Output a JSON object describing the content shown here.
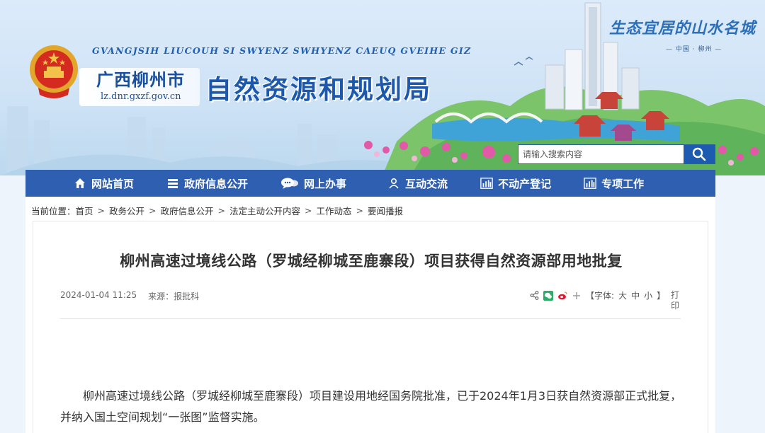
{
  "header": {
    "zhuang_name": "GVANGJSIH LIUCOUH SI SWYENZ SWHYENZ CAEUQ GVEIHE GIZ",
    "city_name": "广西柳州市",
    "domain": "lz.dnr.gxzf.gov.cn",
    "bureau_name": "自然资源和规划局",
    "slogan": "生态宜居的山水名城",
    "slogan_sub": "— 中国 · 柳州 —"
  },
  "search": {
    "placeholder": "请输入搜索内容",
    "icon": "search-icon"
  },
  "nav": {
    "items": [
      {
        "label": "网站首页",
        "icon": "home-icon"
      },
      {
        "label": "政府信息公开",
        "icon": "document-icon"
      },
      {
        "label": "网上办事",
        "icon": "chat-icon"
      },
      {
        "label": "互动交流",
        "icon": "user-icon"
      },
      {
        "label": "不动产登记",
        "icon": "bar-chart-icon"
      },
      {
        "label": "专项工作",
        "icon": "bar-chart-icon"
      }
    ]
  },
  "breadcrumb": {
    "prefix": "当前位置：",
    "items": [
      "首页",
      "政务公开",
      "政府信息公开",
      "法定主动公开内容",
      "工作动态",
      "要闻播报"
    ],
    "separator": ">"
  },
  "article": {
    "title": "柳州高速过境线公路（罗城经柳城至鹿寨段）项目获得自然资源部用地批复",
    "date": "2024-01-04 11:25",
    "source": "来源：报批科",
    "font_size_label": "【字体:",
    "font_large": "大",
    "font_medium": "中",
    "font_small": "小",
    "font_size_close": "】",
    "print": "打印",
    "body": "柳州高速过境线公路（罗城经柳城至鹿寨段）项目建设用地经国务院批准，已于2024年1月3日获自然资源部正式批复，并纳入国土空间规划“一张图”监督实施。"
  },
  "colors": {
    "nav_bg": "#2e5fb0",
    "brand_blue": "#1c58ac",
    "search_btn": "#1d5bb0"
  }
}
